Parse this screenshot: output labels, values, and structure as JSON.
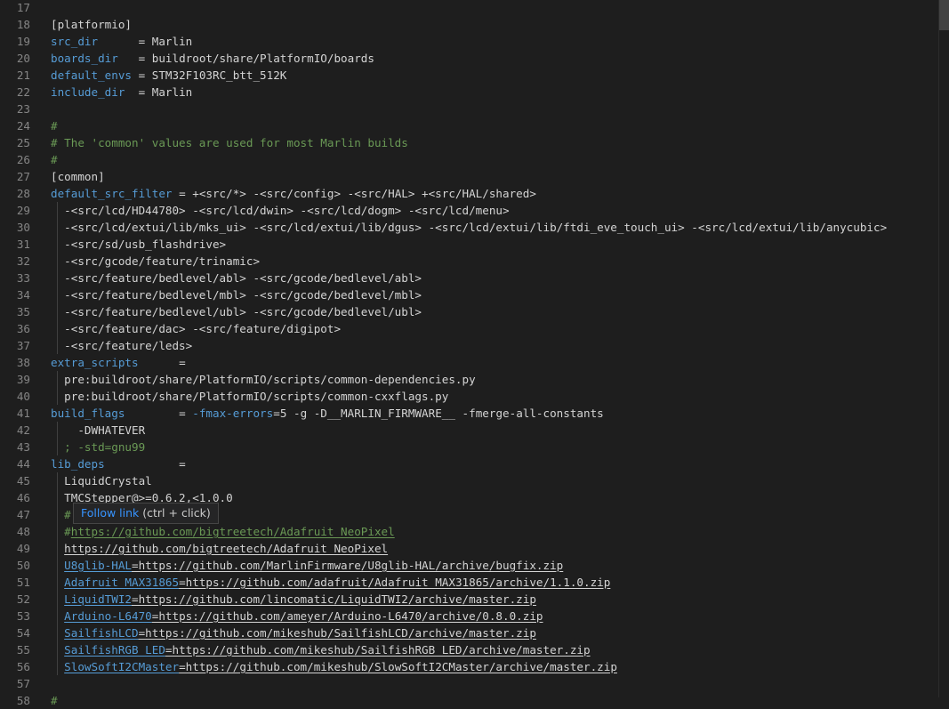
{
  "editor": {
    "tooltip": {
      "link_text": "Follow link",
      "hint": " (ctrl + click)"
    },
    "lines": [
      {
        "n": "17",
        "parts": []
      },
      {
        "n": "18",
        "parts": [
          {
            "t": "[platformio]"
          }
        ]
      },
      {
        "n": "19",
        "parts": [
          {
            "t": "src_dir",
            "c": "key"
          },
          {
            "t": "      = Marlin"
          }
        ]
      },
      {
        "n": "20",
        "parts": [
          {
            "t": "boards_dir",
            "c": "key"
          },
          {
            "t": "   = buildroot/share/PlatformIO/boards"
          }
        ]
      },
      {
        "n": "21",
        "parts": [
          {
            "t": "default_envs",
            "c": "key"
          },
          {
            "t": " = STM32F103RC_btt_512K"
          }
        ]
      },
      {
        "n": "22",
        "parts": [
          {
            "t": "include_dir",
            "c": "key"
          },
          {
            "t": "  = Marlin"
          }
        ]
      },
      {
        "n": "23",
        "parts": []
      },
      {
        "n": "24",
        "parts": [
          {
            "t": "#",
            "c": "comment"
          }
        ]
      },
      {
        "n": "25",
        "parts": [
          {
            "t": "# The 'common' values are used for most Marlin builds",
            "c": "comment"
          }
        ]
      },
      {
        "n": "26",
        "parts": [
          {
            "t": "#",
            "c": "comment"
          }
        ]
      },
      {
        "n": "27",
        "parts": [
          {
            "t": "[common]"
          }
        ]
      },
      {
        "n": "28",
        "parts": [
          {
            "t": "default_src_filter",
            "c": "key"
          },
          {
            "t": " = +<src/*> -<src/config> -<src/HAL> +<src/HAL/shared>"
          }
        ]
      },
      {
        "n": "29",
        "parts": [
          {
            "t": "  -<src/lcd/HD44780> -<src/lcd/dwin> -<src/lcd/dogm> -<src/lcd/menu>"
          }
        ]
      },
      {
        "n": "30",
        "parts": [
          {
            "t": "  -<src/lcd/extui/lib/mks_ui> -<src/lcd/extui/lib/dgus> -<src/lcd/extui/lib/ftdi_eve_touch_ui> -<src/lcd/extui/lib/anycubic>"
          }
        ]
      },
      {
        "n": "31",
        "parts": [
          {
            "t": "  -<src/sd/usb_flashdrive>"
          }
        ]
      },
      {
        "n": "32",
        "parts": [
          {
            "t": "  -<src/gcode/feature/trinamic>"
          }
        ]
      },
      {
        "n": "33",
        "parts": [
          {
            "t": "  -<src/feature/bedlevel/abl> -<src/gcode/bedlevel/abl>"
          }
        ]
      },
      {
        "n": "34",
        "parts": [
          {
            "t": "  -<src/feature/bedlevel/mbl> -<src/gcode/bedlevel/mbl>"
          }
        ]
      },
      {
        "n": "35",
        "parts": [
          {
            "t": "  -<src/feature/bedlevel/ubl> -<src/gcode/bedlevel/ubl>"
          }
        ]
      },
      {
        "n": "36",
        "parts": [
          {
            "t": "  -<src/feature/dac> -<src/feature/digipot>"
          }
        ]
      },
      {
        "n": "37",
        "parts": [
          {
            "t": "  -<src/feature/leds>"
          }
        ]
      },
      {
        "n": "38",
        "parts": [
          {
            "t": "extra_scripts",
            "c": "key"
          },
          {
            "t": "      ="
          }
        ]
      },
      {
        "n": "39",
        "parts": [
          {
            "t": "  pre:buildroot/share/PlatformIO/scripts/common-dependencies.py"
          }
        ]
      },
      {
        "n": "40",
        "parts": [
          {
            "t": "  pre:buildroot/share/PlatformIO/scripts/common-cxxflags.py"
          }
        ]
      },
      {
        "n": "41",
        "parts": [
          {
            "t": "build_flags",
            "c": "key"
          },
          {
            "t": "        = "
          },
          {
            "t": "-fmax-errors",
            "c": "key"
          },
          {
            "t": "=5 -g -D__MARLIN_FIRMWARE__ -fmerge-all-constants"
          }
        ]
      },
      {
        "n": "42",
        "parts": [
          {
            "t": "    -DWHATEVER"
          }
        ]
      },
      {
        "n": "43",
        "parts": [
          {
            "t": "  ; -std=gnu99",
            "c": "comment"
          }
        ]
      },
      {
        "n": "44",
        "parts": [
          {
            "t": "lib_deps",
            "c": "key"
          },
          {
            "t": "           ="
          }
        ]
      },
      {
        "n": "45",
        "parts": [
          {
            "t": "  LiquidCrystal"
          }
        ]
      },
      {
        "n": "46",
        "parts": [
          {
            "t": "  TMCStepper@>=0.6.2,<1.0.0"
          }
        ]
      },
      {
        "n": "47",
        "parts": [
          {
            "t": "  #",
            "c": "comment"
          }
        ]
      },
      {
        "n": "48",
        "parts": [
          {
            "t": "  #",
            "c": "comment"
          },
          {
            "t": "https://github.com/bigtreetech/Adafruit_NeoPixel",
            "c": "comment link"
          }
        ]
      },
      {
        "n": "49",
        "parts": [
          {
            "t": "  "
          },
          {
            "t": "https://github.com/bigtreetech/Adafruit_NeoPixel",
            "c": "link"
          }
        ]
      },
      {
        "n": "50",
        "parts": [
          {
            "t": "  "
          },
          {
            "t": "U8glib-HAL",
            "c": "key link"
          },
          {
            "t": "=https://github.com/MarlinFirmware/U8glib-HAL/archive/bugfix.zip",
            "c": "link"
          }
        ]
      },
      {
        "n": "51",
        "parts": [
          {
            "t": "  "
          },
          {
            "t": "Adafruit_MAX31865",
            "c": "key link"
          },
          {
            "t": "=https://github.com/adafruit/Adafruit_MAX31865/archive/1.1.0.zip",
            "c": "link"
          }
        ]
      },
      {
        "n": "52",
        "parts": [
          {
            "t": "  "
          },
          {
            "t": "LiquidTWI2",
            "c": "key link"
          },
          {
            "t": "=https://github.com/lincomatic/LiquidTWI2/archive/master.zip",
            "c": "link"
          }
        ]
      },
      {
        "n": "53",
        "parts": [
          {
            "t": "  "
          },
          {
            "t": "Arduino-L6470",
            "c": "key link"
          },
          {
            "t": "=https://github.com/ameyer/Arduino-L6470/archive/0.8.0.zip",
            "c": "link"
          }
        ]
      },
      {
        "n": "54",
        "parts": [
          {
            "t": "  "
          },
          {
            "t": "SailfishLCD",
            "c": "key link"
          },
          {
            "t": "=https://github.com/mikeshub/SailfishLCD/archive/master.zip",
            "c": "link"
          }
        ]
      },
      {
        "n": "55",
        "parts": [
          {
            "t": "  "
          },
          {
            "t": "SailfishRGB_LED",
            "c": "key link"
          },
          {
            "t": "=https://github.com/mikeshub/SailfishRGB_LED/archive/master.zip",
            "c": "link"
          }
        ]
      },
      {
        "n": "56",
        "parts": [
          {
            "t": "  "
          },
          {
            "t": "SlowSoftI2CMaster",
            "c": "key link"
          },
          {
            "t": "=https://github.com/mikeshub/SlowSoftI2CMaster/archive/master.zip",
            "c": "link"
          }
        ]
      },
      {
        "n": "57",
        "parts": []
      },
      {
        "n": "58",
        "parts": [
          {
            "t": "#",
            "c": "comment"
          }
        ]
      }
    ]
  }
}
